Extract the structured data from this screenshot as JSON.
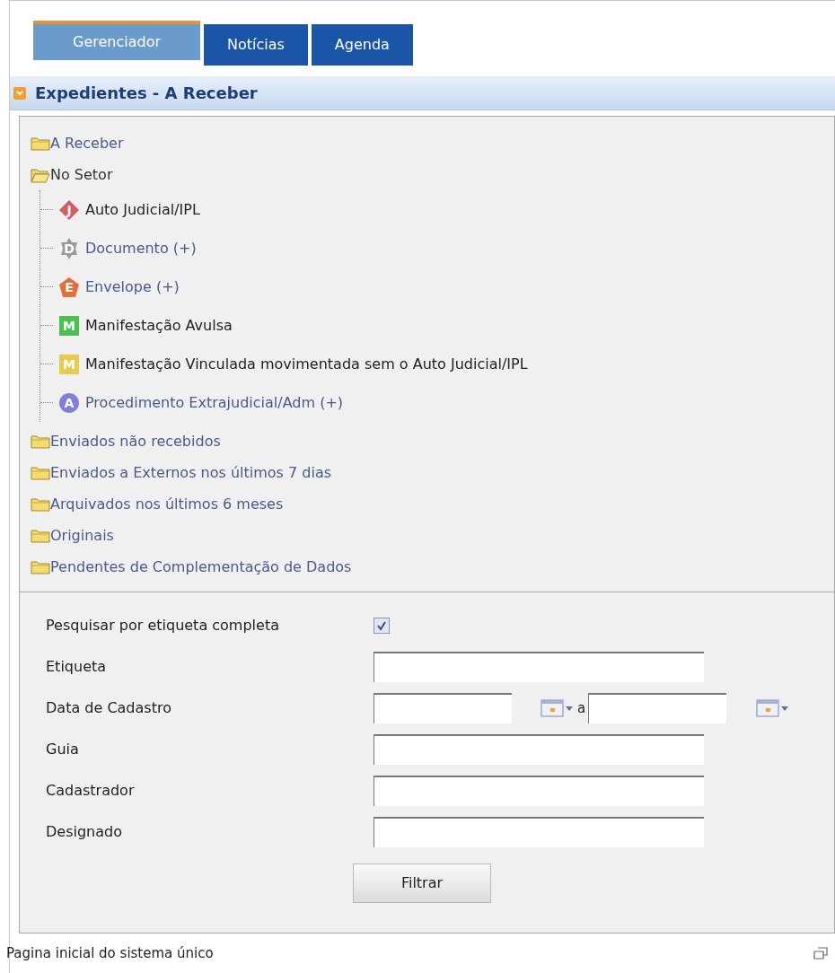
{
  "tabs": [
    {
      "label": "Gerenciador",
      "selected": true
    },
    {
      "label": "Notícias",
      "selected": false
    },
    {
      "label": "Agenda",
      "selected": false
    }
  ],
  "panel": {
    "title": "Expedientes - A Receber",
    "expanded": true
  },
  "tree": [
    {
      "label": "A Receber",
      "expanded": false,
      "link": true
    },
    {
      "label": "No Setor",
      "expanded": true,
      "link": false,
      "children": [
        {
          "label": "Auto Judicial/IPL",
          "kind": "diamond",
          "badge": "J",
          "color": "#d06060",
          "link": false
        },
        {
          "label": "Documento (+)",
          "kind": "star",
          "badge": "D",
          "color": "#9a9a9a",
          "link": true
        },
        {
          "label": "Envelope (+)",
          "kind": "pentagon",
          "badge": "E",
          "color": "#e2703c",
          "link": true
        },
        {
          "label": "Manifestação Avulsa",
          "kind": "square",
          "badge": "M",
          "color": "#4cbf50",
          "link": false
        },
        {
          "label": "Manifestação Vinculada movimentada sem o Auto Judicial/IPL",
          "kind": "square",
          "badge": "M",
          "color": "#e3cc50",
          "link": false
        },
        {
          "label": "Procedimento Extrajudicial/Adm (+)",
          "kind": "circle",
          "badge": "A",
          "color": "#8080d8",
          "link": true
        }
      ]
    },
    {
      "label": "Enviados não recebidos",
      "expanded": false,
      "link": true
    },
    {
      "label": "Enviados a Externos nos últimos 7 dias",
      "expanded": false,
      "link": true
    },
    {
      "label": "Arquivados nos últimos 6 meses",
      "expanded": false,
      "link": true
    },
    {
      "label": "Originais",
      "expanded": false,
      "link": true
    },
    {
      "label": "Pendentes de Complementação de Dados",
      "expanded": false,
      "link": true
    }
  ],
  "form": [
    {
      "kind": "checkbox",
      "label": "Pesquisar por etiqueta completa",
      "checked": true
    },
    {
      "kind": "text",
      "label": "Etiqueta"
    },
    {
      "kind": "daterange",
      "label": "Data de Cadastro",
      "separator": "a"
    },
    {
      "kind": "text",
      "label": "Guia"
    },
    {
      "kind": "text",
      "label": "Cadastrador"
    },
    {
      "kind": "text",
      "label": "Designado"
    }
  ],
  "button": "Filtrar",
  "status_bar": "Pagina inicial do sistema único"
}
